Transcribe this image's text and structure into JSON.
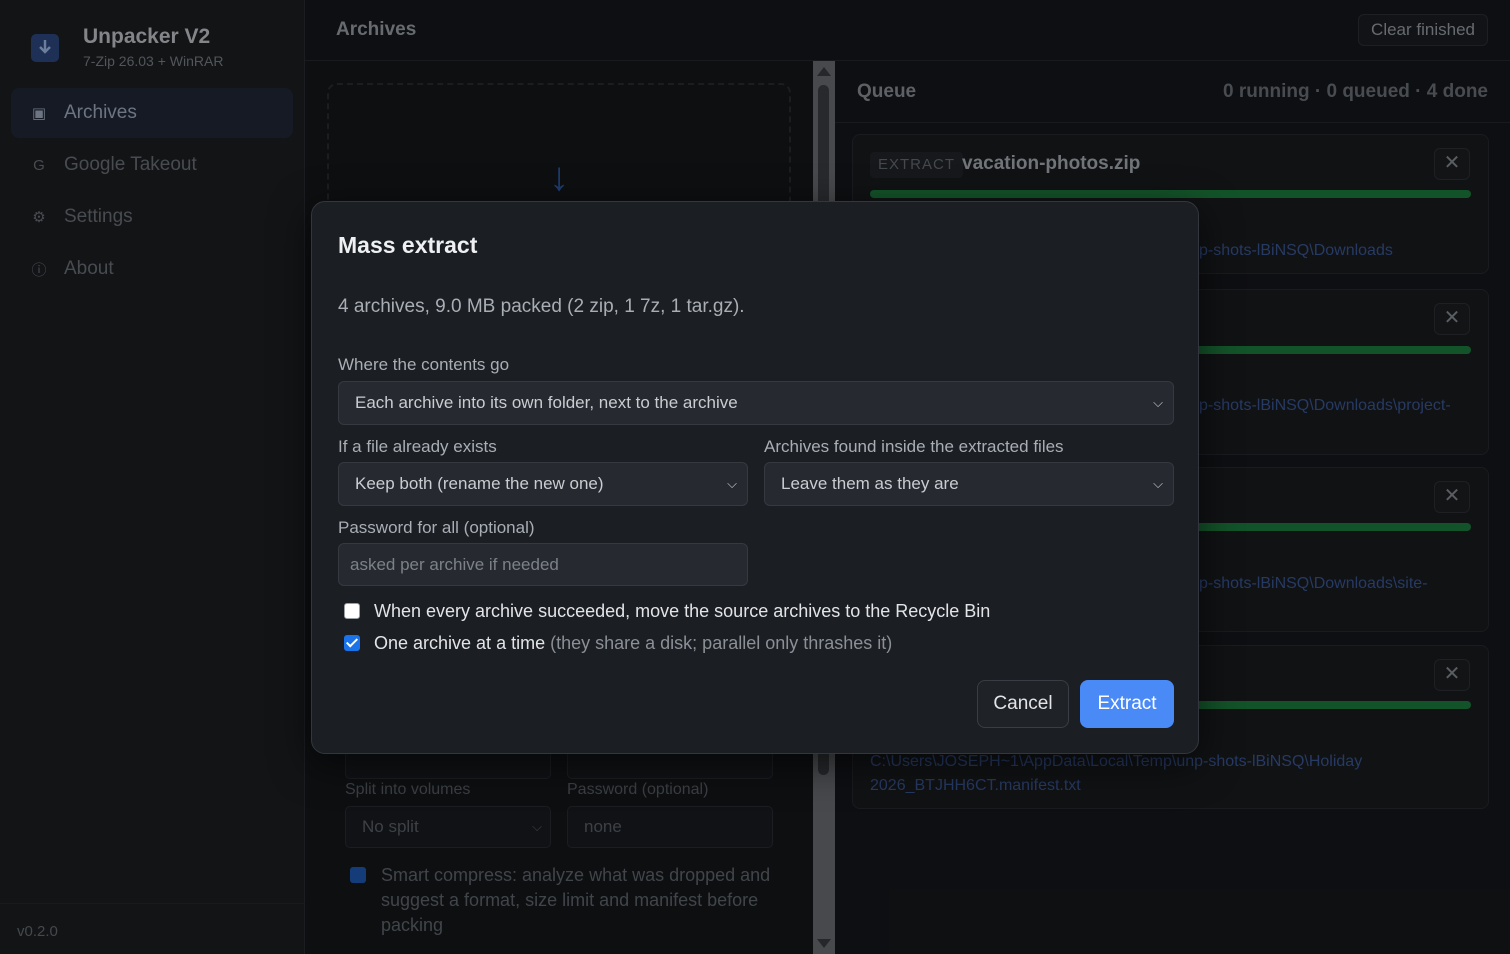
{
  "app": {
    "title": "Unpacker V2",
    "subtitle": "7-Zip 26.03 + WinRAR",
    "version": "v0.2.0"
  },
  "sidebar": {
    "items": [
      {
        "label": "Archives",
        "icon": "archive-icon",
        "glyph": "▣",
        "active": true
      },
      {
        "label": "Google Takeout",
        "icon": "google-icon",
        "glyph": "G",
        "active": false
      },
      {
        "label": "Settings",
        "icon": "gear-icon",
        "glyph": "⚙",
        "active": false
      },
      {
        "label": "About",
        "icon": "info-icon",
        "glyph": "ⓘ",
        "active": false
      }
    ]
  },
  "header": {
    "title": "Archives",
    "clear_label": "Clear finished"
  },
  "left_panel": {
    "split_label": "Split into volumes",
    "split_value": "No split",
    "password_label": "Password (optional)",
    "password_placeholder": "none",
    "smart_compress": "Smart compress: analyze what was dropped and suggest a format, size limit and manifest before packing"
  },
  "queue": {
    "title": "Queue",
    "stats": "0 running · 0 queued · 4 done",
    "jobs": [
      {
        "badge": "EXTRACT",
        "name": "vacation-photos.zip",
        "path": "p-shots-lBiNSQ\\Downloads"
      },
      {
        "badge": "",
        "name": "",
        "path": "p-shots-lBiNSQ\\Downloads\\project-"
      },
      {
        "badge": "",
        "name": "",
        "path": "p-shots-lBiNSQ\\Downloads\\site-"
      },
      {
        "badge": "",
        "name": "",
        "path": "C:\\Users\\JOSEPH~1\\AppData\\Local\\Temp\\unp-shots-lBiNSQ\\Holiday 2026_BTJHH6CT.manifest.txt"
      }
    ]
  },
  "modal": {
    "title": "Mass extract",
    "summary": "4 archives, 9.0 MB packed (2 zip, 1 7z, 1 tar.gz).",
    "dest_label": "Where the contents go",
    "dest_value": "Each archive into its own folder, next to the archive",
    "exists_label": "If a file already exists",
    "exists_value": "Keep both (rename the new one)",
    "nested_label": "Archives found inside the extracted files",
    "nested_value": "Leave them as they are",
    "password_label": "Password for all (optional)",
    "password_placeholder": "asked per archive if needed",
    "recycle_label": "When every archive succeeded, move the source archives to the Recycle Bin",
    "recycle_checked": false,
    "one_at_a_time_label": "One archive at a time",
    "one_at_a_time_hint": "(they share a disk; parallel only thrashes it)",
    "one_at_a_time_checked": true,
    "cancel_label": "Cancel",
    "extract_label": "Extract"
  },
  "colors": {
    "accent": "#4a8af7",
    "progress": "#1e8040",
    "link": "#3d5a9a",
    "background": "#17191d"
  }
}
